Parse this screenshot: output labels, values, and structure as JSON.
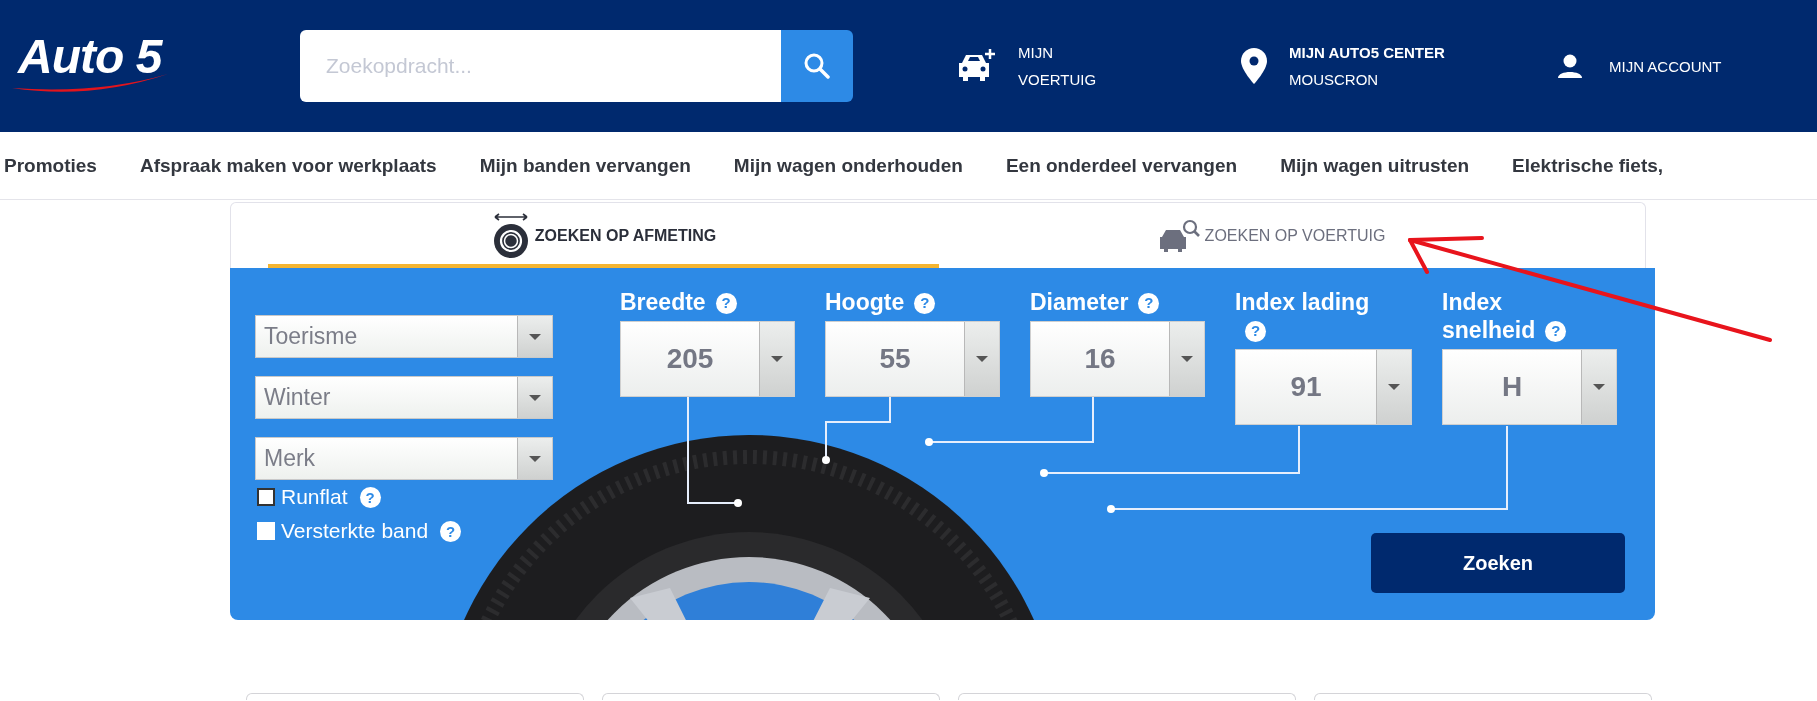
{
  "header": {
    "logo": "Auto 5",
    "search": {
      "placeholder": "Zoekopdracht..."
    },
    "links": [
      {
        "kind": "vehicle",
        "lines": [
          "MIJN",
          "VOERTUIG"
        ]
      },
      {
        "kind": "center",
        "lines": [
          "MIJN AUTO5 CENTER",
          "MOUSCRON"
        ]
      },
      {
        "kind": "account",
        "lines": [
          "MIJN ACCOUNT"
        ]
      }
    ]
  },
  "nav": [
    "Promoties",
    "Afspraak maken voor werkplaats",
    "Mijn banden vervangen",
    "Mijn wagen onderhouden",
    "Een onderdeel vervangen",
    "Mijn wagen uitrusten",
    "Elektrische fiets,"
  ],
  "search_tabs": [
    {
      "kind": "size",
      "label": "ZOEKEN OP AFMETING",
      "selected": true
    },
    {
      "kind": "vehicle",
      "label": "ZOEKEN OP VOERTUIG",
      "selected": false
    }
  ],
  "filters": [
    {
      "value": "Toerisme"
    },
    {
      "value": "Winter"
    },
    {
      "value": "Merk"
    }
  ],
  "options": [
    {
      "label": "Runflat",
      "checked": false,
      "help": "?"
    },
    {
      "label": "Versterkte band",
      "checked": false,
      "help": "?"
    }
  ],
  "size_fields": [
    {
      "label": "Breedte",
      "help": "?",
      "value": "205"
    },
    {
      "label": "Hoogte",
      "help": "?",
      "value": "55"
    },
    {
      "label": "Diameter",
      "help": "?",
      "value": "16"
    },
    {
      "label": "Index lading",
      "help": "?",
      "value": "91"
    },
    {
      "label": "Index snelheid",
      "help": "?",
      "value": "H"
    }
  ],
  "search_button": "Zoeken"
}
